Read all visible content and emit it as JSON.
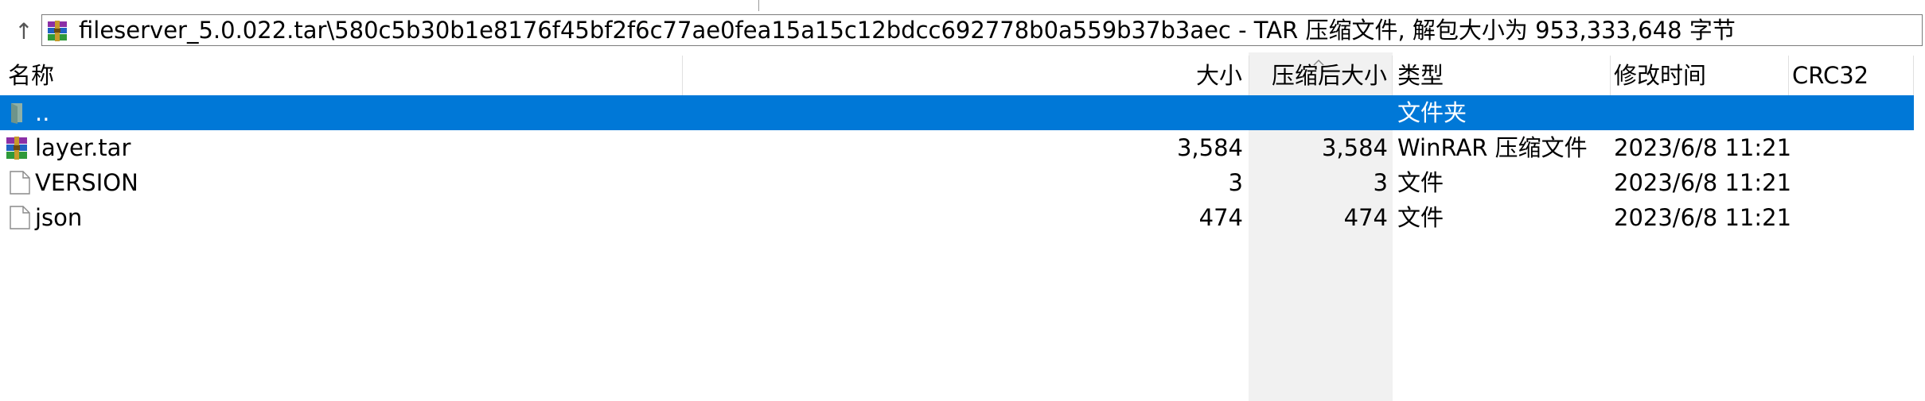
{
  "address": {
    "path": "fileserver_5.0.022.tar\\580c5b30b1e8176f45bf2f6c77ae0fea15a15c12bdcc692778b0a559b37b3aec - TAR 压缩文件, 解包大小为 953,333,648 字节",
    "archive_icon": "winrar-archive-icon",
    "up_icon": "up-arrow-icon"
  },
  "columns": {
    "name": "名称",
    "size": "大小",
    "packed": "压缩后大小",
    "type": "类型",
    "modified": "修改时间",
    "crc": "CRC32"
  },
  "files": [
    {
      "name": "..",
      "size": "",
      "packed": "",
      "type": "文件夹",
      "modified": "",
      "crc": "",
      "icon": "folder-up-icon",
      "selected": true
    },
    {
      "name": "layer.tar",
      "size": "3,584",
      "packed": "3,584",
      "type": "WinRAR 压缩文件",
      "modified": "2023/6/8 11:21",
      "crc": "",
      "icon": "winrar-archive-icon",
      "selected": false
    },
    {
      "name": "VERSION",
      "size": "3",
      "packed": "3",
      "type": "文件",
      "modified": "2023/6/8 11:21",
      "crc": "",
      "icon": "file-icon",
      "selected": false
    },
    {
      "name": "json",
      "size": "474",
      "packed": "474",
      "type": "文件",
      "modified": "2023/6/8 11:21",
      "crc": "",
      "icon": "file-icon",
      "selected": false
    }
  ],
  "colors": {
    "selection": "#0078d7",
    "sorted_column_shade": "#f1f1f1"
  }
}
